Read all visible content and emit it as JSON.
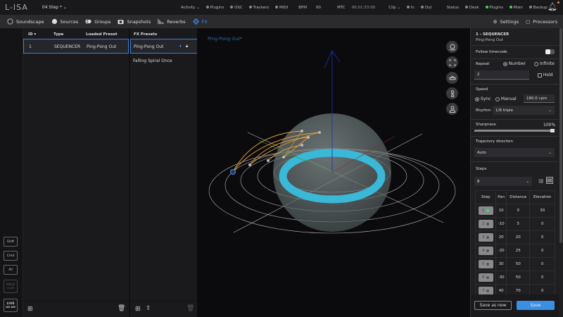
{
  "topbar": {
    "logo": "L-ISA",
    "project": "04 Step *",
    "activity": "Activity",
    "indicators": [
      "Plugins",
      "OSC",
      "Trackers",
      "MIDI"
    ],
    "bpm_label": "BPM",
    "bpm": "60",
    "mtc_label": "MTC",
    "mtc": "00:01:53:00",
    "clip": "Clip",
    "clip_in": "In",
    "clip_out": "Out",
    "status_label": "Status",
    "status": [
      {
        "label": "Desk",
        "color": "#888888"
      },
      {
        "label": "Plugins",
        "color": "#3ddc4a"
      },
      {
        "label": "Main",
        "color": "#3ddc4a"
      },
      {
        "label": "Backup",
        "color": "#888888"
      }
    ],
    "notification_badge_color": "#e08a2a"
  },
  "nav": {
    "items": [
      "Soundscape",
      "Sources",
      "Groups",
      "Snapshots",
      "Reverbs",
      "FX"
    ],
    "active": "FX",
    "settings": "Settings",
    "processors": "Processors",
    "accent": "#3b8fe0"
  },
  "left_strip": {
    "shift": "Shift",
    "cmd": "Cmd",
    "alt": "All",
    "solo": "SOLO",
    "solo_sub": "CLEAR",
    "live": "LIVE",
    "live_sub": "ON AIR"
  },
  "fx_table": {
    "headers": [
      "ID",
      "Type",
      "Loaded Preset"
    ],
    "rows": [
      {
        "id": "1",
        "type": "SEQUENCER",
        "preset": "Ping-Pong Out"
      }
    ]
  },
  "fx_presets": {
    "header": "FX Presets",
    "items": [
      "Ping-Pong Out",
      "Falling Spiral Once"
    ]
  },
  "viewport": {
    "title": "Ping-Pong Out*"
  },
  "right_panel": {
    "title": "1 - SEQUENCER",
    "subtitle": "Ping-Pong Out",
    "follow_timecode": "Follow timecode",
    "repeat": "Repeat",
    "number": "Number",
    "infinite": "Infinite",
    "repeat_value": "2",
    "hold": "Hold",
    "speed": "Speed",
    "sync": "Sync",
    "manual": "Manual",
    "cpm": "180.0 cpm",
    "rhythm": "Rhythm",
    "rhythm_value": "1/8 triple",
    "sharpness": "Sharpness",
    "sharpness_value": "100%",
    "sharpness_level": 1.0,
    "trajectory": "Trajectory direction",
    "trajectory_value": "Auto",
    "steps": "Steps",
    "steps_count": "8",
    "step_headers": [
      "Step",
      "Pan",
      "Distance",
      "Elevation"
    ],
    "step_rows": [
      {
        "step": "1",
        "pan": "10",
        "distance": "0",
        "elevation": "30",
        "active": true
      },
      {
        "step": "2",
        "pan": "-10",
        "distance": "5",
        "elevation": "0"
      },
      {
        "step": "3",
        "pan": "20",
        "distance": "20",
        "elevation": "0"
      },
      {
        "step": "4",
        "pan": "-20",
        "distance": "25",
        "elevation": "0"
      },
      {
        "step": "5",
        "pan": "30",
        "distance": "50",
        "elevation": "0"
      },
      {
        "step": "6",
        "pan": "-30",
        "distance": "50",
        "elevation": "0"
      },
      {
        "step": "7",
        "pan": "40",
        "distance": "70",
        "elevation": "0"
      }
    ],
    "save_as_new": "Save as new",
    "save": "Save"
  }
}
